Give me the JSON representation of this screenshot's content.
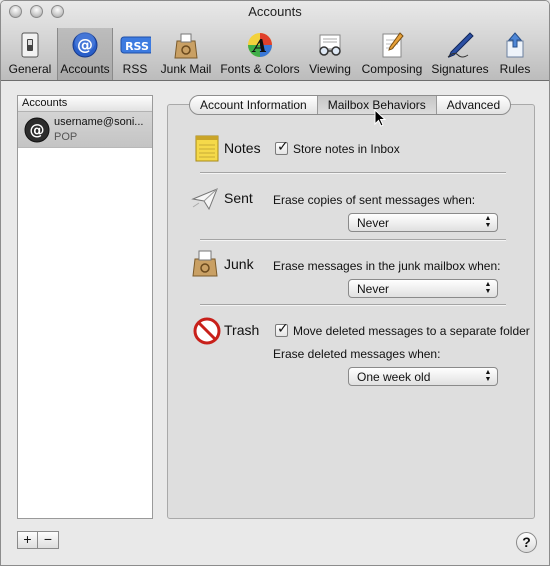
{
  "window": {
    "title": "Accounts"
  },
  "toolbar": {
    "items": [
      {
        "label": "General",
        "icon": "switch-icon"
      },
      {
        "label": "Accounts",
        "icon": "at-sign-icon",
        "selected": true
      },
      {
        "label": "RSS",
        "icon": "rss-icon"
      },
      {
        "label": "Junk Mail",
        "icon": "junk-bag-icon"
      },
      {
        "label": "Fonts & Colors",
        "icon": "font-color-icon"
      },
      {
        "label": "Viewing",
        "icon": "glasses-icon"
      },
      {
        "label": "Composing",
        "icon": "pencil-paper-icon"
      },
      {
        "label": "Signatures",
        "icon": "pen-icon"
      },
      {
        "label": "Rules",
        "icon": "rules-icon"
      }
    ]
  },
  "sidebar": {
    "header": "Accounts",
    "accounts": [
      {
        "name": "username@soni...",
        "type": "POP",
        "selected": true
      }
    ],
    "add_label": "+",
    "remove_label": "−"
  },
  "tabs": [
    {
      "label": "Account Information",
      "active": false
    },
    {
      "label": "Mailbox Behaviors",
      "active": true
    },
    {
      "label": "Advanced",
      "active": false
    }
  ],
  "sections": {
    "notes": {
      "title": "Notes",
      "checkbox_label": "Store notes in Inbox",
      "checked": true
    },
    "sent": {
      "title": "Sent",
      "label": "Erase copies of sent messages when:",
      "value": "Never"
    },
    "junk": {
      "title": "Junk",
      "label": "Erase messages in the junk mailbox when:",
      "value": "Never"
    },
    "trash": {
      "title": "Trash",
      "checkbox_label": "Move deleted messages to a separate folder",
      "checked": true,
      "label": "Erase deleted messages when:",
      "value": "One week old"
    }
  },
  "help_label": "?",
  "colors": {
    "accent_blue": "#2a5fc9",
    "trash_red": "#c8201a",
    "notes_yellow": "#f5d94a"
  }
}
